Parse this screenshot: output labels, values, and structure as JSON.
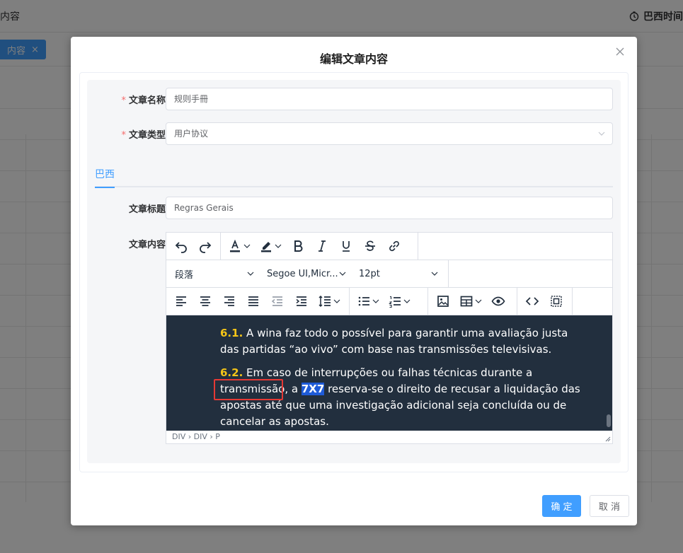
{
  "background": {
    "page_title_partial": "内容",
    "user_label_partial": "巴西时间",
    "tag_label": "内容"
  },
  "dialog": {
    "title": "编辑文章内容",
    "fields": {
      "name_label": "文章名称",
      "name_value": "规则手冊",
      "type_label": "文章类型",
      "type_value": "用户协议",
      "title_label": "文章标题",
      "title_value": "Regras Gerais",
      "content_label": "文章内容"
    },
    "tabs": [
      "巴西"
    ],
    "editor": {
      "block_format": "段落",
      "font_family": "Segoe UI,Micr...",
      "font_size": "12pt",
      "paragraphs": [
        {
          "num": "6.1.",
          "text": " A wina faz todo o possível para garantir uma avaliação justa das partidas “ao vivo” com base nas transmissões televisivas."
        },
        {
          "num": "6.2.",
          "text_before": " Em caso de interrupções ou falhas técnicas durante a transmissão, a ",
          "highlight": "7X7",
          "text_after": " reserva-se o direito de recusar a liquidação das apostas até que uma investigação adicional seja concluída ou de cancelar as apostas."
        }
      ],
      "status_path": "DIV › DIV › P"
    },
    "buttons": {
      "confirm": "确 定",
      "cancel": "取 消"
    }
  },
  "colors": {
    "primary": "#409eff",
    "editor_bg": "#222f3e",
    "number_highlight": "#f5c518",
    "selection": "#1e5bd8",
    "annotation_box": "#e53935",
    "required_star": "#f56c6c"
  }
}
